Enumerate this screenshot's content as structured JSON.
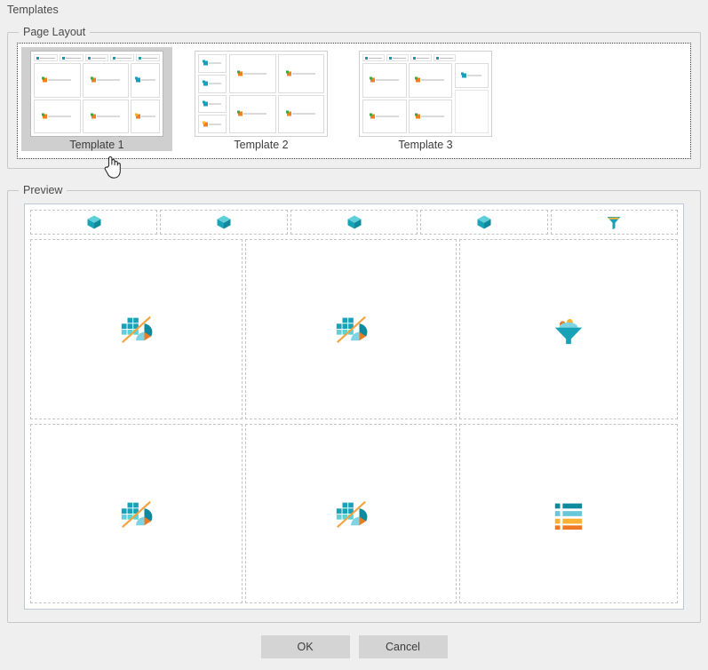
{
  "dialog": {
    "title": "Templates"
  },
  "page_layout": {
    "group_title": "Page Layout",
    "templates": [
      {
        "id": "template-1",
        "label": "Template 1",
        "selected": true
      },
      {
        "id": "template-2",
        "label": "Template 2",
        "selected": false
      },
      {
        "id": "template-3",
        "label": "Template 3",
        "selected": false
      }
    ]
  },
  "preview": {
    "group_title": "Preview",
    "top_row": [
      {
        "icon": "cube-icon"
      },
      {
        "icon": "cube-icon"
      },
      {
        "icon": "cube-icon"
      },
      {
        "icon": "cube-icon"
      },
      {
        "icon": "funnel-icon"
      }
    ],
    "rows": [
      [
        {
          "icon": "chart-icon"
        },
        {
          "icon": "chart-icon"
        },
        {
          "icon": "funnel-large-icon"
        }
      ],
      [
        {
          "icon": "chart-icon"
        },
        {
          "icon": "chart-icon"
        },
        {
          "icon": "list-icon"
        }
      ]
    ]
  },
  "footer": {
    "ok_label": "OK",
    "cancel_label": "Cancel"
  },
  "cursor": {
    "icon": "hand-pointer-cursor"
  },
  "colors": {
    "teal": "#18a2b8",
    "teal_dark": "#0e8a9c",
    "cyan_light": "#66c8d8",
    "orange": "#ef7822",
    "amber": "#f9b233",
    "background": "#efefef",
    "panel_border": "#c8c8c8",
    "selection": "#cfcfcf",
    "button": "#d4d4d4"
  }
}
